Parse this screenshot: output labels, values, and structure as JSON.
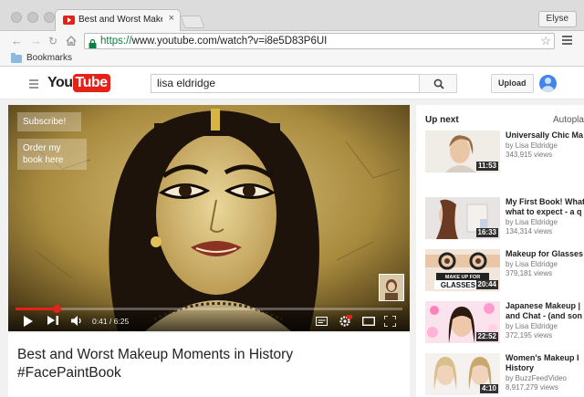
{
  "browser": {
    "tab_title": "Best and Worst Makeup Mo",
    "tab_close": "×",
    "user_label": "Elyse",
    "url_scheme": "https://",
    "url_rest": "www.youtube.com/watch?v=i8e5D83P6UI",
    "bookmarks_label": "Bookmarks"
  },
  "masthead": {
    "logo_you": "You",
    "logo_tube": "Tube",
    "search_value": "lisa eldridge",
    "upload_label": "Upload"
  },
  "player": {
    "overlay_subscribe": "Subscribe!",
    "overlay_order": "Order my book here",
    "time_current": "0:41",
    "time_separator": "/",
    "time_total": "6:25",
    "progress_fraction": 0.106,
    "colors": {
      "progress": "#e62117"
    }
  },
  "video": {
    "title": "Best and Worst Makeup Moments in History #FacePaintBook"
  },
  "sidebar": {
    "up_next": "Up next",
    "autoplay": "Autoplay",
    "items": [
      {
        "title1": "Universally Chic Ma",
        "title2": "",
        "channel": "by Lisa Eldridge",
        "views": "343,915 views",
        "duration": "11:53"
      },
      {
        "title1": "My First Book! What",
        "title2": "what to expect - a q",
        "channel": "by Lisa Eldridge",
        "views": "134,314 views",
        "duration": "16:33"
      },
      {
        "title1": "Makeup for Glasses",
        "title2": "",
        "channel": "by Lisa Eldridge",
        "views": "379,181 views",
        "duration": "20:44"
      },
      {
        "title1": "Japanese Makeup |",
        "title2": "and Chat - (and son",
        "channel": "by Lisa Eldridge",
        "views": "372,195 views",
        "duration": "22:52"
      },
      {
        "title1": "Women's Makeup I",
        "title2": "History",
        "channel": "by BuzzFeedVideo",
        "views": "8,917,279 views",
        "duration": "4:10"
      }
    ]
  }
}
